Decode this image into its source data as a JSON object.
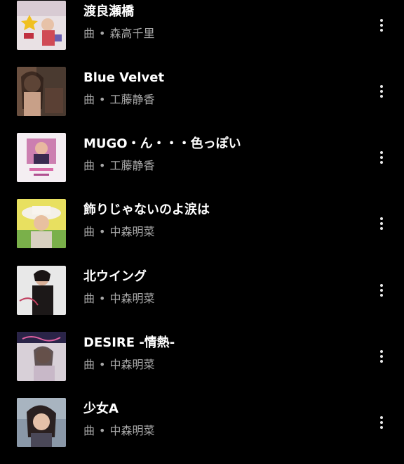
{
  "songs": [
    {
      "title": "渡良瀬橋",
      "type": "曲",
      "separator": "•",
      "artist": "森高千里"
    },
    {
      "title": "Blue Velvet",
      "type": "曲",
      "separator": "•",
      "artist": "工藤静香"
    },
    {
      "title": "MUGO・ん・・・色っぽい",
      "type": "曲",
      "separator": "•",
      "artist": "工藤静香"
    },
    {
      "title": "飾りじゃないのよ涙は",
      "type": "曲",
      "separator": "•",
      "artist": "中森明菜"
    },
    {
      "title": "北ウイング",
      "type": "曲",
      "separator": "•",
      "artist": "中森明菜"
    },
    {
      "title": "DESIRE -情熱-",
      "type": "曲",
      "separator": "•",
      "artist": "中森明菜"
    },
    {
      "title": "少女A",
      "type": "曲",
      "separator": "•",
      "artist": "中森明菜"
    }
  ],
  "colors": {
    "background": "#000000",
    "title": "#ffffff",
    "meta": "#a8a8a8",
    "more_icon": "#e8e8e8"
  },
  "icons": {
    "more": "more-vertical-icon"
  }
}
